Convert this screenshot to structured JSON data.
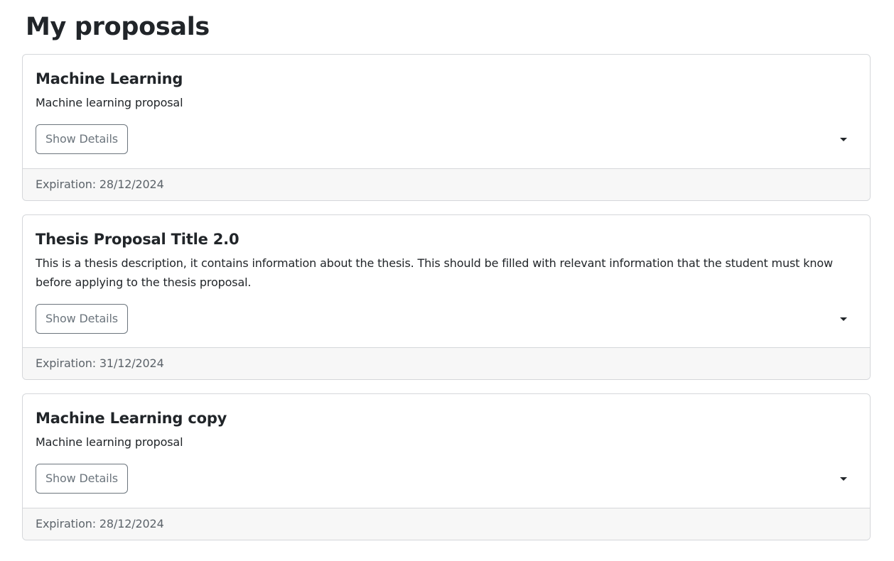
{
  "page": {
    "title": "My proposals"
  },
  "proposals": [
    {
      "title": "Machine Learning",
      "description": "Machine learning proposal",
      "button_label": "Show Details",
      "footer_label": "Expiration:",
      "expiration": "28/12/2024",
      "footer_text": "Expiration: 28/12/2024"
    },
    {
      "title": "Thesis Proposal Title 2.0",
      "description": "This is a thesis description, it contains information about the thesis. This should be filled with relevant information that the student must know before applying to the thesis proposal.",
      "button_label": "Show Details",
      "footer_label": "Expiration:",
      "expiration": "31/12/2024",
      "footer_text": "Expiration: 31/12/2024"
    },
    {
      "title": "Machine Learning copy",
      "description": "Machine learning proposal",
      "button_label": "Show Details",
      "footer_label": "Expiration:",
      "expiration": "28/12/2024",
      "footer_text": "Expiration: 28/12/2024"
    }
  ],
  "icons": {
    "expand": "caret-down-icon"
  },
  "colors": {
    "text": "#212529",
    "secondary": "#6c757d",
    "footer_bg": "#f7f7f7",
    "border": "#d5d7da"
  }
}
